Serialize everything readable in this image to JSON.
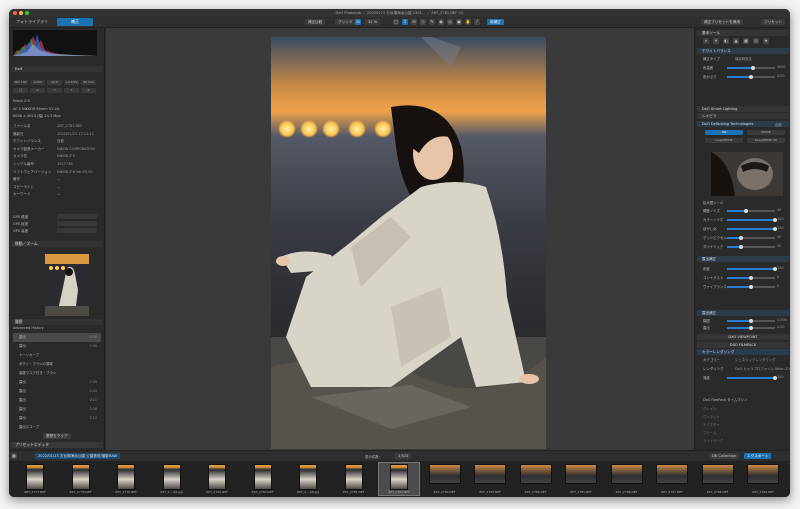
{
  "window": {
    "title": "DxO PhotoLab — 20220123 お台場海浜公園 2301… ／ Z6T_2781.NEF (1)"
  },
  "toolbar": {
    "tab_library": "フォトライブラリ",
    "tab_customize": "補正",
    "btn_compare": "補正比較",
    "btn_grid": "グリッド",
    "btn_straighten": "水平",
    "zoom": "32 %",
    "btn_preview": "前補正",
    "btn_apply_preset": "補正プリセットを適用",
    "btn_presets": "プリセット",
    "accent": "#1b73b3"
  },
  "left": {
    "exif_title": "Exif",
    "exif_chips": [
      "ISO 100",
      "1/200",
      "f/2.8",
      "+0.0 EV",
      "85 mm"
    ],
    "camera": "Nikon Z 6",
    "lens": "AF-S NIKKOR 85mm f/1.4G",
    "size": "6048 × 4024 (幅) 24.3 Mpx",
    "metadata": [
      {
        "label": "ファイル名",
        "value": "Z6T_2781.NEF"
      },
      {
        "label": "撮影日",
        "value": "2022/01/23 17:11:12"
      },
      {
        "label": "ホワイトバランス",
        "value": "自動"
      },
      {
        "label": "カメラ製造メーカー",
        "value": "NIKON CORPORATION"
      },
      {
        "label": "カメラ名",
        "value": "NIKON Z 6"
      },
      {
        "label": "シリアル番号",
        "value": "3017736"
      },
      {
        "label": "ソフトウェアバージョン",
        "value": "NIKON Z 6 Ver.03.00"
      },
      {
        "label": "著作",
        "value": "—"
      },
      {
        "label": "コピーライト",
        "value": "—"
      },
      {
        "label": "キーワード",
        "value": "—"
      }
    ],
    "gps": [
      {
        "label": "GPS 緯度",
        "value": ""
      },
      {
        "label": "GPS 経度",
        "value": ""
      },
      {
        "label": "GPS 高度",
        "value": ""
      }
    ],
    "panel_navigator": "移動／ズーム",
    "panel_history": "履歴",
    "history_title": "Advanced History",
    "history": [
      {
        "label": "露出",
        "value": "0.00"
      },
      {
        "label": "露出",
        "value": "0.30"
      },
      {
        "label": "トーンカーブ",
        "value": ""
      },
      {
        "label": "ボディ・ブラシの領域",
        "value": ""
      },
      {
        "label": "高度マスク付き・ブラシ",
        "value": ""
      },
      {
        "label": "露出",
        "value": "0.35"
      },
      {
        "label": "露出",
        "value": "0.20"
      },
      {
        "label": "露出",
        "value": "0.11"
      },
      {
        "label": "露出",
        "value": "0.06"
      },
      {
        "label": "露出",
        "value": "0.12"
      },
      {
        "label": "露出スコープ",
        "value": ""
      }
    ],
    "history_btn": "履歴をクリア",
    "panel_preset": "プリセットエディタ"
  },
  "right": {
    "title": "基本ツール",
    "wb_header": "ホワイトバランス",
    "wb_rows": [
      {
        "label": "補正タイプ",
        "value": "撮影時設定"
      },
      {
        "label": "色温度",
        "value": "4900"
      },
      {
        "label": "色かぶり",
        "value": "0.00"
      }
    ],
    "sections": [
      "DxO Smart Lighting",
      "レイビラ",
      "DxO DeNoising Technologies"
    ],
    "denoise_mode": "自動",
    "denoise_options": [
      "HQ",
      "PRIME",
      "DeepPRIME",
      "DeepPRIME XD"
    ],
    "loupe_label": "拡大鏡ツール",
    "denoise_rows": [
      {
        "label": "輝度ノイズ",
        "value": "40"
      },
      {
        "label": "カラーノイズ",
        "value": "100"
      },
      {
        "label": "ぼかし化",
        "value": "100"
      },
      {
        "label": "デッドピクセル",
        "value": "30"
      },
      {
        "label": "ダイナミック",
        "value": "30"
      }
    ],
    "sec_tone": "露出補正",
    "tone_rows": [
      {
        "label": "彩度",
        "value": "100"
      },
      {
        "label": "コントラスト",
        "value": "0"
      },
      {
        "label": "ヴァイブランス",
        "value": "0"
      }
    ],
    "sec_crop": "露出補正",
    "crop_rows": [
      {
        "label": "構図",
        "value": "0.000"
      },
      {
        "label": "露出",
        "value": "0.00"
      }
    ],
    "sec_viewpoint": "DXO VIEWPOINT",
    "sec_filmpack": "DXO FILMPACK",
    "color_header": "カラーレンダリング",
    "color_rows": [
      {
        "label": "カテゴリー",
        "value": "ジェネリックレンダリング"
      },
      {
        "label": "レンダリング",
        "value": "DxO カメラプロファイル Nikon Z 6"
      },
      {
        "label": "強度",
        "value": "100"
      }
    ],
    "filmpack_label": "DxO FilmPack タイムマシン",
    "bottom_rows": [
      "グレイン",
      "ヴィネット",
      "テクスチャ",
      "フレーム",
      "ライトリーク"
    ]
  },
  "bottombar": {
    "path": "2022/01/23 お台場海浜公園 公園鉄塔/撮影RAW",
    "sort_label": "表示件数：",
    "count": "1,623",
    "btn_export": "エクスポート",
    "btn_collection": "DB Collection"
  },
  "filmstrip": [
    "Z6T_2777.NEF",
    "Z6T_2778.NEF",
    "Z6T_2779.NEF",
    "Z6T_2....99.jpg",
    "Z6T_2780.NEF",
    "Z6T_2780.NEF",
    "Z6T_2....98.jpg",
    "Z6T_2781.NEF",
    "Z6T_2781.NEF",
    "Z6T_2782.NEF",
    "Z6T_2783.NEF",
    "Z6T_2784.NEF",
    "Z6T_2785.NEF",
    "Z6T_2786.NEF",
    "Z6T_2787.NEF",
    "Z6T_2788.NEF",
    "Z6T_2789.NEF"
  ]
}
